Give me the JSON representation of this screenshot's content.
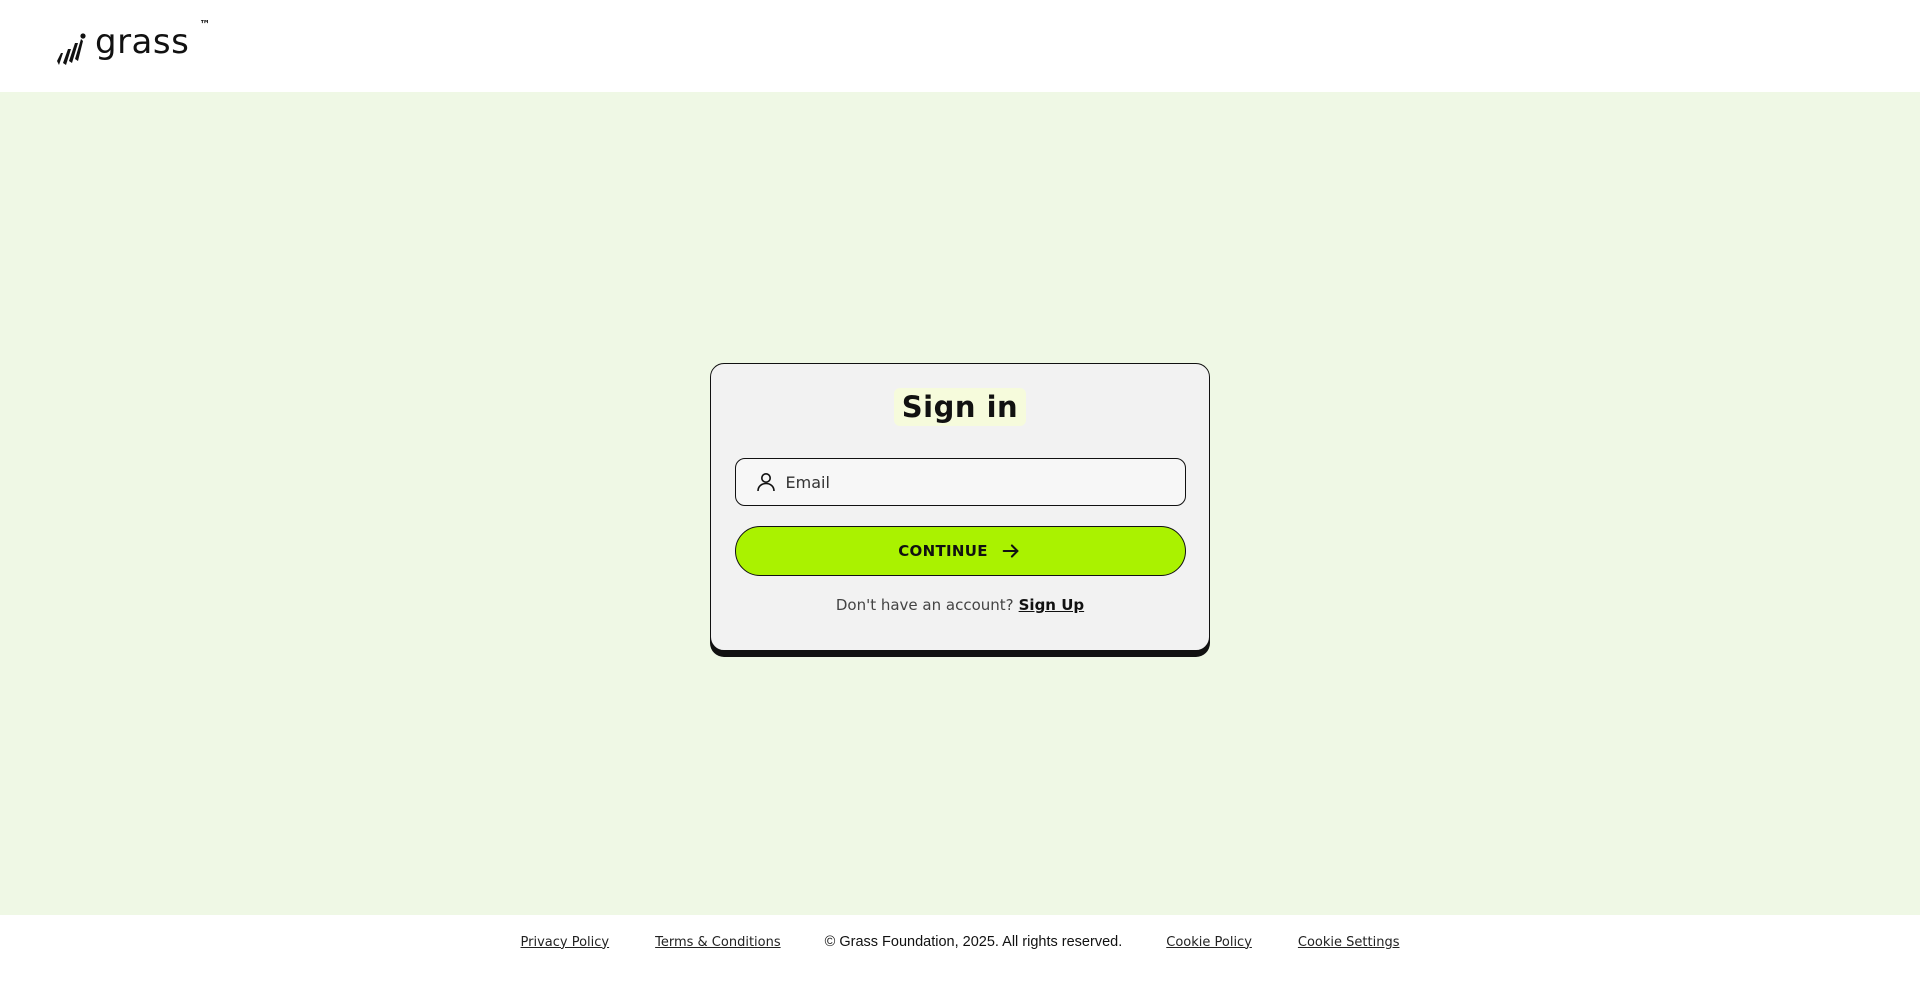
{
  "header": {
    "logo_text": "grass",
    "logo_trademark": "™"
  },
  "signin": {
    "title": "Sign in",
    "email_placeholder": "Email",
    "email_value": "",
    "continue_label": "CONTINUE",
    "no_account_text": "Don't have an account?",
    "signup_label": "Sign Up"
  },
  "footer": {
    "privacy_label": "Privacy Policy",
    "terms_label": "Terms & Conditions",
    "copyright": "© Grass Foundation, 2025. All rights reserved.",
    "cookie_policy_label": "Cookie Policy",
    "cookie_settings_label": "Cookie Settings"
  },
  "colors": {
    "background": "#eff8e5",
    "accent": "#aaf200",
    "card": "#f2f2f2",
    "title_highlight": "#f6fbdc"
  },
  "icons": {
    "logo": "grass-logo-icon",
    "email": "user-icon",
    "continue": "arrow-right-icon"
  }
}
